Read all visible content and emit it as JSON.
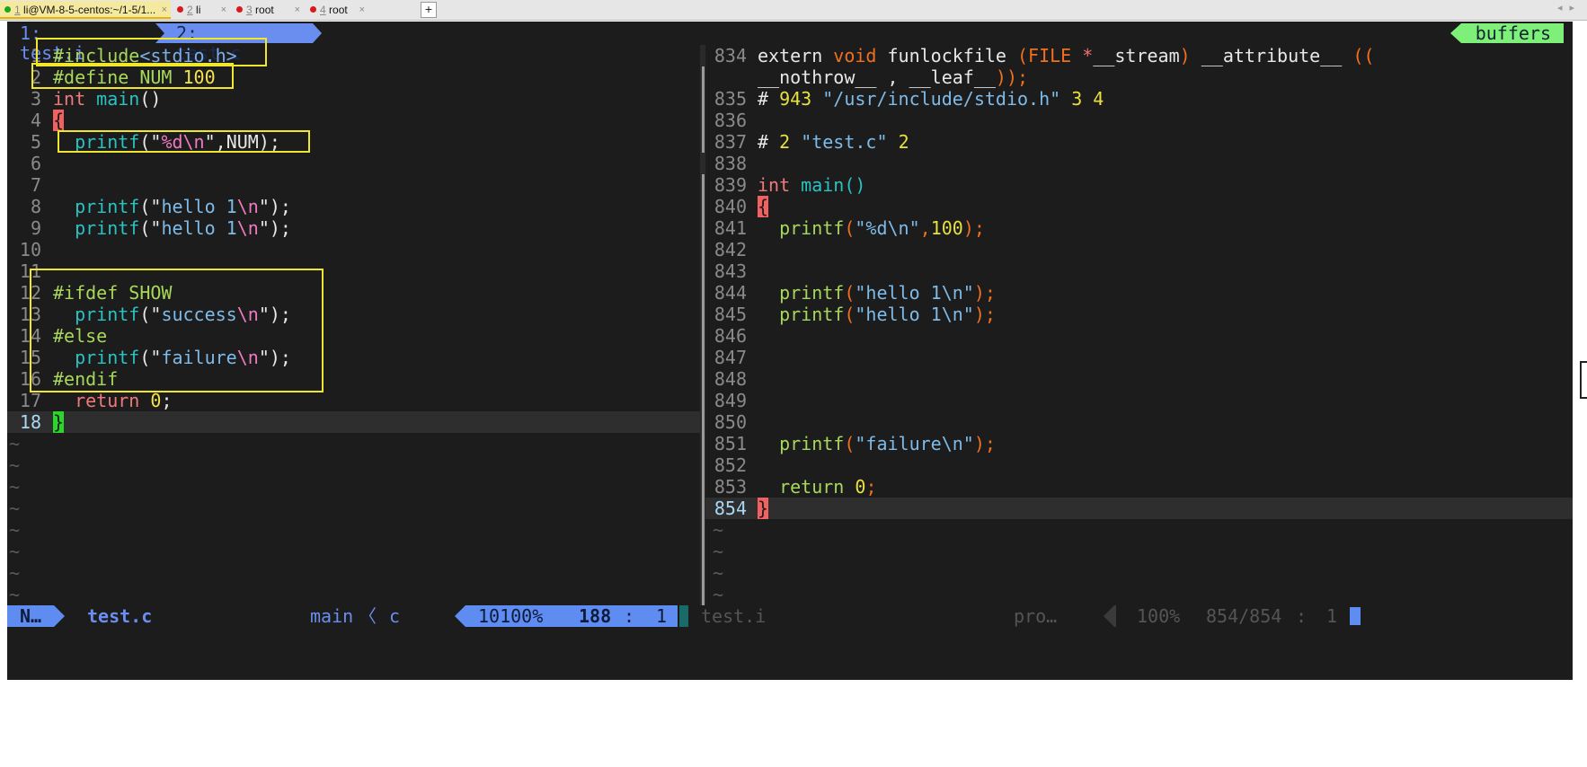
{
  "terminal_tabs": [
    {
      "num": "1",
      "label": "li@VM-8-5-centos:~/1-5/1...",
      "dot": "#1aa81a",
      "close": "×"
    },
    {
      "num": "2",
      "label": "li",
      "dot": "#d81a1a",
      "close": "×"
    },
    {
      "num": "3",
      "label": "root",
      "dot": "#d81a1a",
      "close": "×"
    },
    {
      "num": "4",
      "label": "root",
      "dot": "#d81a1a",
      "close": "×"
    }
  ],
  "add_tab": "+",
  "scroll_arrows": "◂▸",
  "vim_tabs": [
    "1: test.i",
    "2: test.c"
  ],
  "buffers_label": "buffers",
  "left_pane": {
    "lines": [
      {
        "n": "1",
        "t": [
          [
            "pp",
            "#include"
          ],
          [
            "hdr",
            "<stdio.h>"
          ]
        ]
      },
      {
        "n": "2",
        "t": [
          [
            "pp",
            "#define NUM "
          ],
          [
            "nm",
            "100"
          ]
        ]
      },
      {
        "n": "3",
        "t": [
          [
            "kw",
            "int "
          ],
          [
            "fn",
            "main"
          ],
          [
            "pl",
            "()"
          ]
        ]
      },
      {
        "n": "4",
        "t": [
          [
            "sym",
            "{"
          ]
        ]
      },
      {
        "n": "5",
        "t": [
          [
            "pl",
            "  "
          ],
          [
            "fn",
            "printf"
          ],
          [
            "pl",
            "(\""
          ],
          [
            "esc",
            "%d\\n"
          ],
          [
            "pl",
            "\",NUM);"
          ]
        ]
      },
      {
        "n": "6",
        "t": []
      },
      {
        "n": "7",
        "t": []
      },
      {
        "n": "8",
        "t": [
          [
            "pl",
            "  "
          ],
          [
            "fn",
            "printf"
          ],
          [
            "pl",
            "(\""
          ],
          [
            "str",
            "hello 1"
          ],
          [
            "esc",
            "\\n"
          ],
          [
            "pl",
            "\");"
          ]
        ]
      },
      {
        "n": "9",
        "t": [
          [
            "pl",
            "  "
          ],
          [
            "fn",
            "printf"
          ],
          [
            "pl",
            "(\""
          ],
          [
            "str",
            "hello 1"
          ],
          [
            "esc",
            "\\n"
          ],
          [
            "pl",
            "\");"
          ]
        ]
      },
      {
        "n": "10",
        "t": []
      },
      {
        "n": "11",
        "t": []
      },
      {
        "n": "12",
        "t": [
          [
            "pp",
            "#ifdef SHOW"
          ]
        ]
      },
      {
        "n": "13",
        "t": [
          [
            "pl",
            "  "
          ],
          [
            "fn",
            "printf"
          ],
          [
            "pl",
            "(\""
          ],
          [
            "str",
            "success"
          ],
          [
            "esc",
            "\\n"
          ],
          [
            "pl",
            "\");"
          ]
        ]
      },
      {
        "n": "14",
        "t": [
          [
            "pp",
            "#else"
          ]
        ]
      },
      {
        "n": "15",
        "t": [
          [
            "pl",
            "  "
          ],
          [
            "fn",
            "printf"
          ],
          [
            "pl",
            "(\""
          ],
          [
            "str",
            "failure"
          ],
          [
            "esc",
            "\\n"
          ],
          [
            "pl",
            "\");"
          ]
        ]
      },
      {
        "n": "16",
        "t": [
          [
            "pp",
            "#endif"
          ]
        ]
      },
      {
        "n": "17",
        "t": [
          [
            "pl",
            "  "
          ],
          [
            "kw",
            "return "
          ],
          [
            "nm",
            "0"
          ],
          [
            "pl",
            ";"
          ]
        ]
      },
      {
        "n": "18",
        "t": [
          [
            "cur",
            "}"
          ]
        ]
      }
    ],
    "tildes": 8
  },
  "right_pane": {
    "lines": [
      {
        "n": "834",
        "t": [
          [
            "pl",
            "extern "
          ],
          [
            "org",
            "void "
          ],
          [
            "pl",
            "funlockfile "
          ],
          [
            "org",
            "(FILE "
          ],
          [
            "sym",
            "*"
          ],
          [
            "pl",
            "__stream"
          ],
          [
            "org",
            ") "
          ],
          [
            "pl",
            "__attribute__ "
          ],
          [
            "org",
            "(("
          ]
        ]
      },
      {
        "n": "",
        "t": [
          [
            "pl",
            "__nothrow__ , __leaf__"
          ],
          [
            "org",
            "));"
          ]
        ]
      },
      {
        "n": "835",
        "t": [
          [
            "pl",
            "# "
          ],
          [
            "ylw",
            "943 "
          ],
          [
            "str",
            "\"/usr/include/stdio.h\" "
          ],
          [
            "ylw",
            "3 4"
          ]
        ]
      },
      {
        "n": "836",
        "t": []
      },
      {
        "n": "837",
        "t": [
          [
            "pl",
            "# "
          ],
          [
            "ylw",
            "2 "
          ],
          [
            "str",
            "\"test.c\" "
          ],
          [
            "ylw",
            "2"
          ]
        ]
      },
      {
        "n": "838",
        "t": []
      },
      {
        "n": "839",
        "t": [
          [
            "kw",
            "int "
          ],
          [
            "fn",
            "main"
          ],
          [
            "fn",
            "()"
          ]
        ]
      },
      {
        "n": "840",
        "t": [
          [
            "sym",
            "{"
          ]
        ]
      },
      {
        "n": "841",
        "t": [
          [
            "pl",
            "  "
          ],
          [
            "grn",
            "printf"
          ],
          [
            "org",
            "("
          ],
          [
            "str",
            "\"%d\\n\""
          ],
          [
            "org",
            ","
          ],
          [
            "ylw",
            "100"
          ],
          [
            "org",
            ");"
          ]
        ]
      },
      {
        "n": "842",
        "t": []
      },
      {
        "n": "843",
        "t": []
      },
      {
        "n": "844",
        "t": [
          [
            "pl",
            "  "
          ],
          [
            "grn",
            "printf"
          ],
          [
            "org",
            "("
          ],
          [
            "str",
            "\"hello 1\\n\""
          ],
          [
            "org",
            ");"
          ]
        ]
      },
      {
        "n": "845",
        "t": [
          [
            "pl",
            "  "
          ],
          [
            "grn",
            "printf"
          ],
          [
            "org",
            "("
          ],
          [
            "str",
            "\"hello 1\\n\""
          ],
          [
            "org",
            ");"
          ]
        ]
      },
      {
        "n": "846",
        "t": []
      },
      {
        "n": "847",
        "t": []
      },
      {
        "n": "848",
        "t": []
      },
      {
        "n": "849",
        "t": []
      },
      {
        "n": "850",
        "t": []
      },
      {
        "n": "851",
        "t": [
          [
            "pl",
            "  "
          ],
          [
            "grn",
            "printf"
          ],
          [
            "org",
            "("
          ],
          [
            "str",
            "\"failure\\n\""
          ],
          [
            "org",
            ");"
          ]
        ]
      },
      {
        "n": "852",
        "t": []
      },
      {
        "n": "853",
        "t": [
          [
            "pl",
            "  "
          ],
          [
            "grn",
            "return "
          ],
          [
            "ylw",
            "0"
          ],
          [
            "org",
            ";"
          ]
        ]
      },
      {
        "n": "854",
        "t": [
          [
            "cursym",
            "}"
          ]
        ]
      }
    ],
    "tildes": 4
  },
  "status": {
    "mode": "N…",
    "file": "test.c",
    "func": "main",
    "sep": "〈",
    "ft": "c",
    "pos_pct": "10100%",
    "line": "188",
    "colon": ":",
    "col": "1",
    "right_file": "test.i",
    "right_ft": "pro…",
    "right_pct": "100%",
    "right_pos": "854/854",
    "right_colon": ":",
    "right_col": "1"
  },
  "colors": {
    "bg": "#1c1c1c",
    "mode_bg": "#5e8cf0",
    "buffers_bg": "#7ef07a",
    "highlight_box": "#f0e62c",
    "cursor_green": "#2bd62b",
    "cursor_red": "#f06262"
  }
}
